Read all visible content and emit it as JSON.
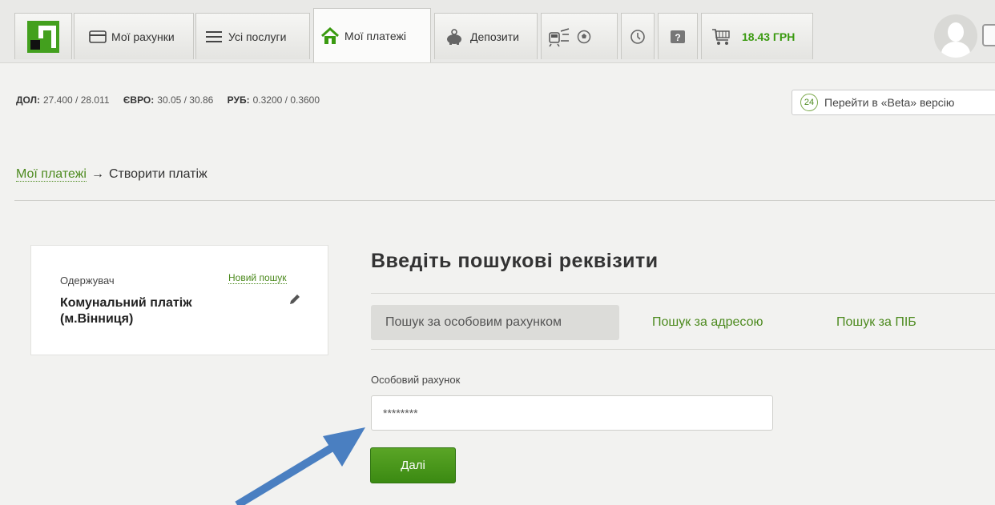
{
  "nav": {
    "tabs": [
      {
        "label": "Мої рахунки",
        "icon": "card-icon"
      },
      {
        "label": "Усі послуги",
        "icon": "list-icon"
      },
      {
        "label": "Мої платежі",
        "icon": "home-icon"
      },
      {
        "label": "Депозити",
        "icon": "piggy-bank-icon"
      }
    ],
    "cart_amount": "18.43 ГРН",
    "brand_color": "#43a01e"
  },
  "rates": {
    "usd_label": "ДОЛ:",
    "usd_value": "27.400 / 28.011",
    "eur_label": "ЄВРО:",
    "eur_value": "30.05 / 30.86",
    "rub_label": "РУБ:",
    "rub_value": "0.3200 / 0.3600"
  },
  "beta": {
    "badge": "24",
    "label": "Перейти в «Beta» версію"
  },
  "breadcrumb": {
    "parent": "Мої платежі",
    "arrow": "→",
    "current": "Створити платіж"
  },
  "recipient": {
    "label": "Одержувач",
    "new_search": "Новий пошук",
    "name": "Комунальний платіж (м.Вінниця)"
  },
  "form": {
    "title": "Введіть пошукові реквізити",
    "tabs": [
      "Пошук за особовим рахунком",
      "Пошук за адресою",
      "Пошук за ПІБ"
    ],
    "field_label": "Особовий рахунок",
    "field_value": "********",
    "submit_label": "Далі"
  },
  "colors": {
    "link": "#4c8a1e",
    "button": "#4a9a1c",
    "annotation_arrow": "#4a7fc1"
  }
}
